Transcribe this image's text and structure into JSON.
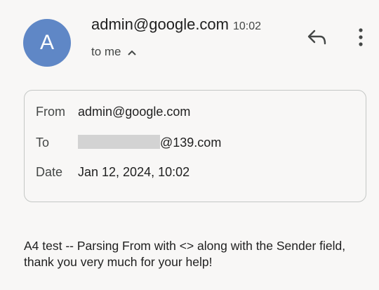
{
  "header": {
    "avatar_letter": "A",
    "avatar_color": "#5f87c6",
    "sender": "admin@google.com",
    "time": "10:02",
    "recipient_summary": "to me",
    "reply_icon": "reply-icon",
    "more_icon": "more-vert-icon",
    "toggle_icon": "chevron-up-icon"
  },
  "details": {
    "from_label": "From",
    "from_value": "admin@google.com",
    "to_label": "To",
    "to_value_suffix": "@139.com",
    "date_label": "Date",
    "date_value": "Jan 12, 2024, 10:02"
  },
  "message": {
    "body": "A4 test -- Parsing From with <> along with the Sender field, thank you very much for your help!"
  }
}
